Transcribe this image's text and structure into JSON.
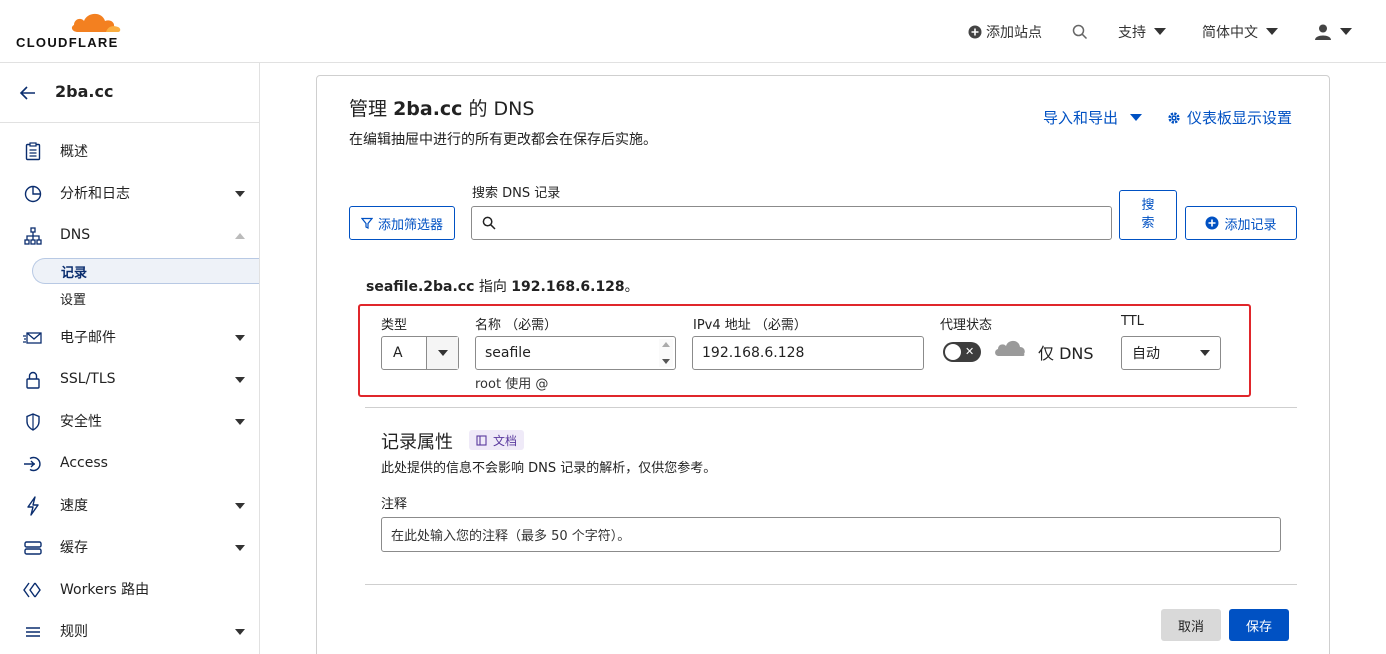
{
  "brand": {
    "logo_text": "CLOUDFLARE",
    "accent": "#f38020"
  },
  "header": {
    "add_site": "添加站点",
    "support": "支持",
    "language": "简体中文"
  },
  "sidebar": {
    "domain": "2ba.cc",
    "items": [
      {
        "label": "概述",
        "icon": "document-icon"
      },
      {
        "label": "分析和日志",
        "icon": "pie-chart-icon"
      },
      {
        "label": "DNS",
        "icon": "network-icon"
      },
      {
        "label": "电子邮件",
        "icon": "mail-icon"
      },
      {
        "label": "SSL/TLS",
        "icon": "lock-icon"
      },
      {
        "label": "安全性",
        "icon": "shield-icon"
      },
      {
        "label": "Access",
        "icon": "access-icon"
      },
      {
        "label": "速度",
        "icon": "bolt-icon"
      },
      {
        "label": "缓存",
        "icon": "cache-icon"
      },
      {
        "label": "Workers 路由",
        "icon": "workers-icon"
      },
      {
        "label": "规则",
        "icon": "rules-icon"
      }
    ],
    "dns_sub": {
      "records": "记录",
      "settings": "设置"
    }
  },
  "main": {
    "title_prefix": "管理",
    "title_domain": "2ba.cc",
    "title_suffix": "的 DNS",
    "subtitle": "在编辑抽屉中进行的所有更改都会在保存后实施。",
    "import_export": "导入和导出",
    "dashboard_settings": "仪表板显示设置",
    "search_label": "搜索 DNS 记录",
    "search_placeholder": "",
    "add_filter": "添加筛选器",
    "search_button": "搜索",
    "add_record": "添加记录",
    "summary_name": "seafile.2ba.cc",
    "summary_mid": "指向",
    "summary_ip": "192.168.6.128",
    "summary_end": "。"
  },
  "edit_form": {
    "type_label": "类型",
    "type_value": "A",
    "name_label": "名称 （必需）",
    "name_value": "seafile",
    "name_hint": "root 使用 @",
    "ipv4_label": "IPv4 地址 （必需）",
    "ipv4_value": "192.168.6.128",
    "proxy_label": "代理状态",
    "proxy_state": "仅 DNS",
    "ttl_label": "TTL",
    "ttl_value": "自动"
  },
  "attributes": {
    "title": "记录属性",
    "docs_badge": "文档",
    "description": "此处提供的信息不会影响 DNS 记录的解析，仅供您参考。",
    "note_label": "注释",
    "note_placeholder": "在此处输入您的注释（最多 50 个字符）。"
  },
  "actions": {
    "cancel": "取消",
    "save": "保存"
  },
  "colors": {
    "link": "#0051c3",
    "highlight_border": "#e0262b"
  }
}
